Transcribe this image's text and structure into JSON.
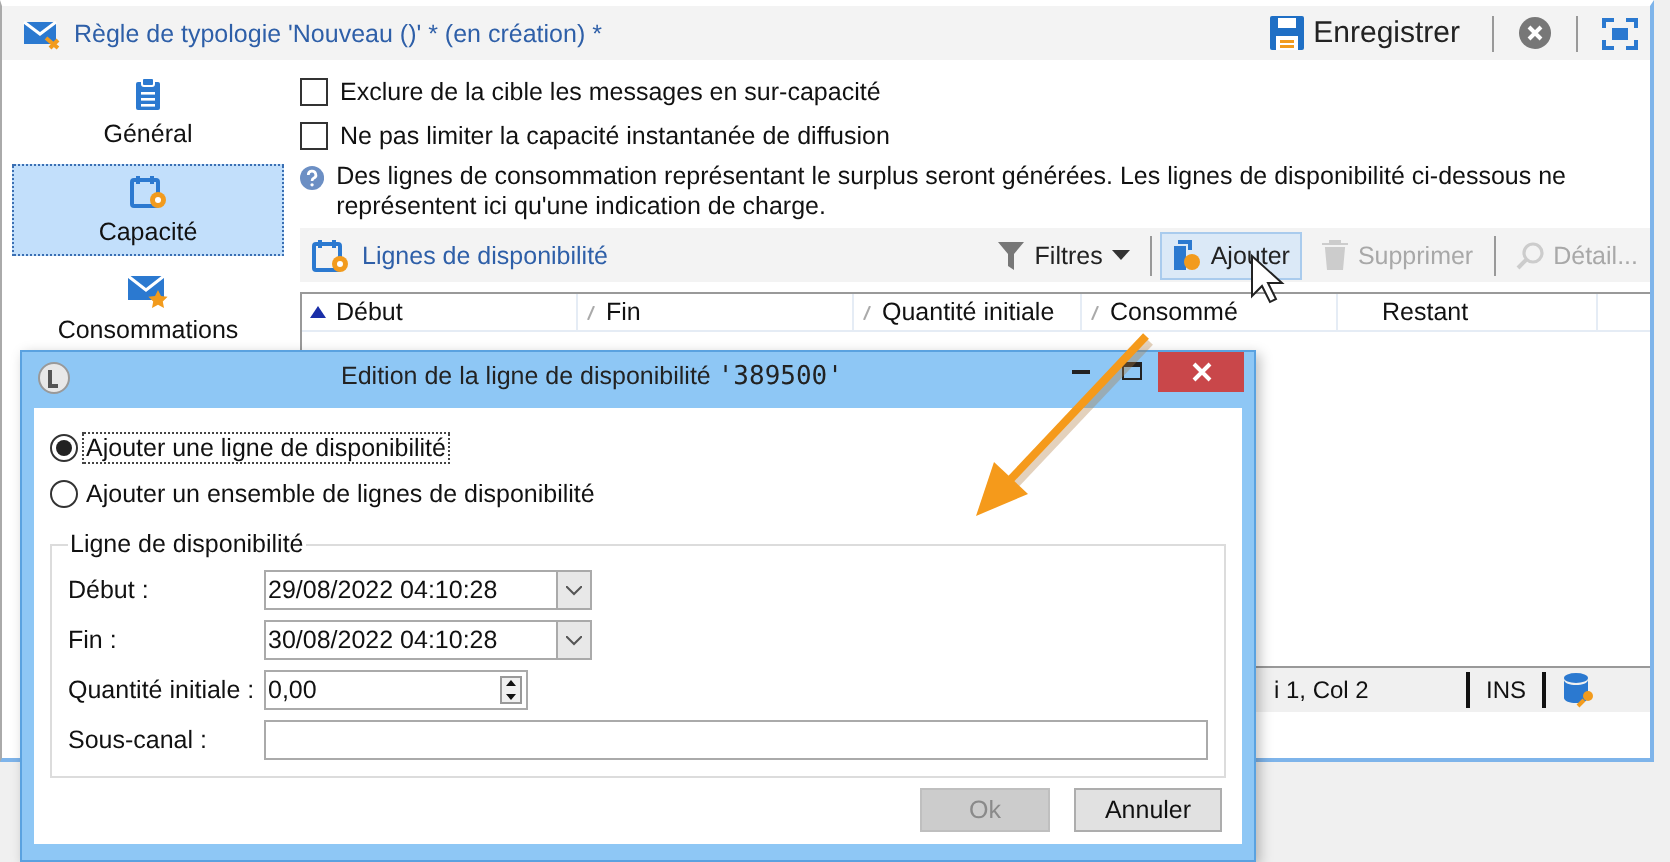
{
  "window": {
    "title": "Règle de typologie 'Nouveau ()' * (en création) *",
    "save_label": "Enregistrer"
  },
  "sidebar": {
    "items": [
      {
        "label": "Général",
        "kind": "general",
        "selected": false
      },
      {
        "label": "Capacité",
        "kind": "capacity",
        "selected": true
      },
      {
        "label": "Consommations",
        "kind": "consumption",
        "selected": false
      }
    ]
  },
  "options": [
    {
      "label": "Exclure de la cible les messages en sur-capacité",
      "checked": false
    },
    {
      "label": "Ne pas limiter la capacité instantanée de diffusion",
      "checked": false
    }
  ],
  "info": "Des lignes de consommation représentant le surplus seront générées. Les lignes de disponibilité ci-dessous ne représentent ici qu'une indication de charge.",
  "list": {
    "title": "Lignes de disponibilité",
    "toolbar": [
      {
        "label": "Filtres",
        "kind": "filter",
        "disabled": false,
        "hovered": false
      },
      {
        "label": "Ajouter",
        "kind": "add",
        "disabled": false,
        "hovered": true
      },
      {
        "label": "Supprimer",
        "kind": "delete",
        "disabled": true,
        "hovered": false
      },
      {
        "label": "Détail...",
        "kind": "detail",
        "disabled": true,
        "hovered": false
      }
    ],
    "columns": [
      {
        "label": "Début",
        "sortable": true,
        "sorted": true
      },
      {
        "label": "Fin",
        "sortable": true,
        "sorted": false
      },
      {
        "label": "Quantité initiale",
        "sortable": true,
        "sorted": false
      },
      {
        "label": "Consommé",
        "sortable": true,
        "sorted": false
      },
      {
        "label": "Restant",
        "sortable": false,
        "sorted": false
      }
    ]
  },
  "status_bar": {
    "position": "i 1, Col 2",
    "mode": "INS"
  },
  "dialog": {
    "title": "Edition de la ligne de disponibilité",
    "title_id": "'389500'",
    "modes": [
      {
        "label": "Ajouter une ligne de disponibilité",
        "selected": true
      },
      {
        "label": "Ajouter un ensemble de lignes de disponibilité",
        "selected": false
      }
    ],
    "group": {
      "title": "Ligne de disponibilité",
      "fields": [
        {
          "label": "Début :",
          "value": "29/08/2022 04:10:28",
          "kind": "date"
        },
        {
          "label": "Fin :",
          "value": "30/08/2022 04:10:28",
          "kind": "date"
        },
        {
          "label": "Quantité initiale :",
          "value": "0,00",
          "kind": "number"
        },
        {
          "label": "Sous-canal :",
          "kind": "text"
        }
      ]
    },
    "buttons": [
      {
        "label": "Ok",
        "disabled": true
      },
      {
        "label": "Annuler",
        "disabled": false
      }
    ]
  }
}
